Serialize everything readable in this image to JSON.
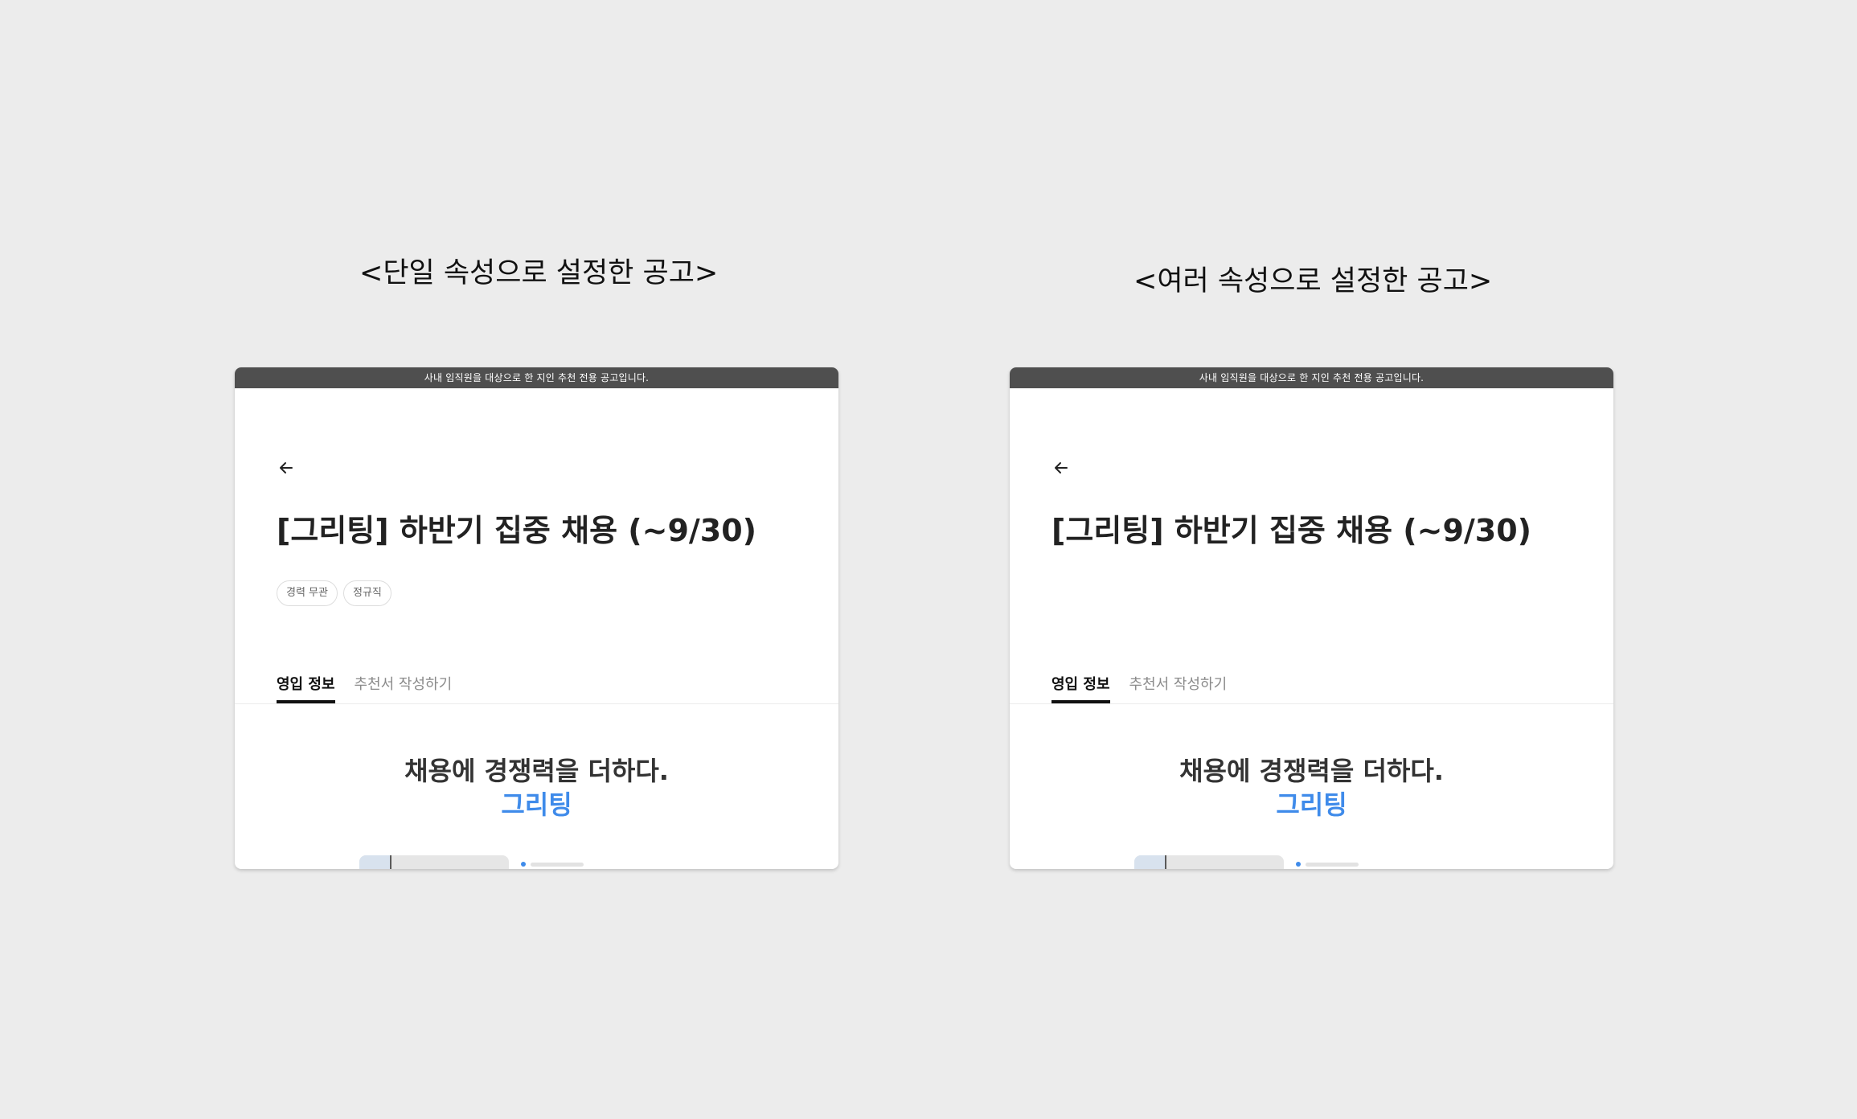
{
  "captions": {
    "left": "<단일 속성으로 설정한 공고>",
    "right": "<여러 속성으로 설정한 공고>"
  },
  "cards": {
    "left": {
      "banner": "사내 임직원을 대상으로 한 지인 추천 전용 공고입니다.",
      "title": "[그리팅] 하반기 집중 채용 (~9/30)",
      "tags": [
        "경력 무관",
        "정규직"
      ],
      "tabs": [
        "영입 정보",
        "추천서 작성하기"
      ],
      "active_tab": 0,
      "hero_line": "채용에 경쟁력을 더하다.",
      "brand": "그리팅"
    },
    "right": {
      "banner": "사내 임직원을 대상으로 한 지인 추천 전용 공고입니다.",
      "title": "[그리팅] 하반기 집중 채용 (~9/30)",
      "tags": [],
      "tabs": [
        "영입 정보",
        "추천서 작성하기"
      ],
      "active_tab": 0,
      "hero_line": "채용에 경쟁력을 더하다.",
      "brand": "그리팅"
    }
  },
  "icons": {
    "back": "arrow-left-icon"
  },
  "colors": {
    "background": "#ececec",
    "banner": "#4f4f4f",
    "brand_blue": "#3f8bea",
    "title_text": "#222222",
    "inactive_tab": "#8a8a8a"
  }
}
